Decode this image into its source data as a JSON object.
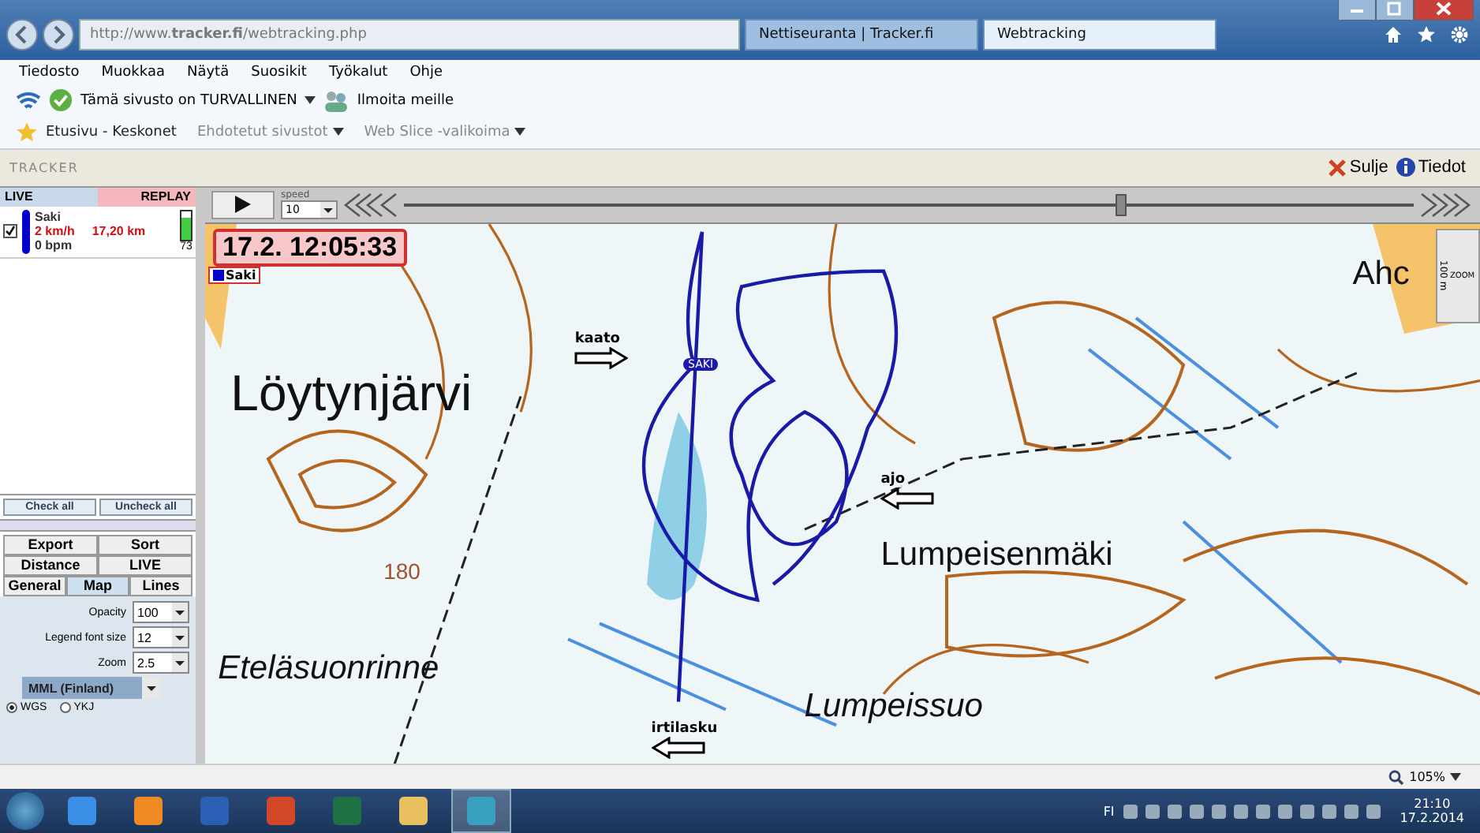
{
  "browser": {
    "url": "http://www.**tracker.fi**/webtracking.php",
    "tabs": [
      {
        "label": "Nettiseuranta | Tracker.fi",
        "selected": false
      },
      {
        "label": "Webtracking",
        "selected": true
      }
    ],
    "menu": [
      "Tiedosto",
      "Muokkaa",
      "Näytä",
      "Suosikit",
      "Työkalut",
      "Ohje"
    ],
    "command_bar": {
      "safety": "Tämä sivusto on TURVALLINEN",
      "report": "Ilmoita meille"
    },
    "favorites": [
      {
        "label": "Etusivu - Keskonet",
        "dropdown": false
      },
      {
        "label": "Ehdotetut sivustot",
        "dropdown": true
      },
      {
        "label": "Web Slice -valikoima",
        "dropdown": true
      }
    ],
    "zoom": "105%"
  },
  "app": {
    "logo": "TRACKER",
    "header_actions": [
      "Sulje",
      "Tiedot"
    ],
    "modes": [
      {
        "label": "LIVE",
        "selected": false
      },
      {
        "label": "REPLAY",
        "selected": true
      }
    ],
    "trackers": [
      {
        "checked": true,
        "color": "#0000cc",
        "name": "Saki",
        "speed": "2 km/h",
        "distance": "17,20 km",
        "heart_rate": "0 bpm",
        "battery": {
          "level": 0.8,
          "reading": "73"
        }
      }
    ],
    "list_buttons": [
      "Check all",
      "Uncheck all"
    ],
    "settings_tabs": [
      [
        {
          "label": "Export",
          "selected": false
        },
        {
          "label": "Sort",
          "selected": false
        }
      ],
      [
        {
          "label": "Distance",
          "selected": false
        },
        {
          "label": "LIVE",
          "selected": false
        }
      ],
      [
        {
          "label": "General",
          "selected": false
        },
        {
          "label": "Map",
          "selected": true
        },
        {
          "label": "Lines",
          "selected": false
        }
      ]
    ],
    "settings": [
      {
        "label": "Opacity",
        "value": "100"
      },
      {
        "label": "Legend font size",
        "value": "12"
      },
      {
        "label": "Zoom",
        "value": "2.5"
      }
    ],
    "map_source": "MML (Finland)",
    "coordinates": [
      {
        "label": "WGS",
        "selected": true
      },
      {
        "label": "YKJ",
        "selected": false
      }
    ],
    "playback": {
      "speed_label": "speed",
      "speed": "10",
      "position": {
        "level": 0.71
      }
    },
    "map": {
      "timestamp": "17.2. 12:05:33",
      "legend": [
        {
          "name": "Saki",
          "color": "#0000cc"
        }
      ],
      "scale": "100 m",
      "zoom_label": "ZOOM",
      "labels": [
        {
          "kind": "lake",
          "text": "Löytynjärvi"
        },
        {
          "kind": "place",
          "text": "Lumpeisenmäki"
        },
        {
          "kind": "slope",
          "text": "Eteläsuonrinne"
        },
        {
          "kind": "marsh",
          "text": "Lumpeissuo"
        },
        {
          "kind": "place",
          "text": "Ahc"
        },
        {
          "kind": "height",
          "text": "180"
        }
      ],
      "marker": "SAKI",
      "annotations": [
        "kaato",
        "ajo",
        "irtilasku"
      ]
    }
  },
  "taskbar": {
    "language": "FI",
    "time": "21:10",
    "date": "17.2.2014"
  }
}
